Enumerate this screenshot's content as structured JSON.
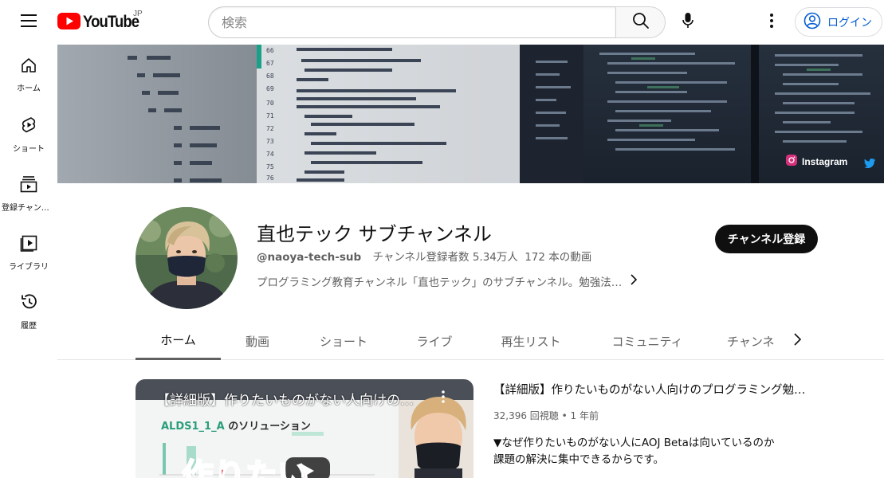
{
  "header": {
    "logo_text": "YouTube",
    "region": "JP",
    "search_placeholder": "検索",
    "login_label": "ログイン"
  },
  "sidebar": {
    "items": [
      {
        "label": "ホーム",
        "icon": "home-icon"
      },
      {
        "label": "ショート",
        "icon": "shorts-icon"
      },
      {
        "label": "登録チャンネル",
        "icon": "subscriptions-icon"
      },
      {
        "label": "ライブラリ",
        "icon": "library-icon"
      },
      {
        "label": "履歴",
        "icon": "history-icon"
      }
    ]
  },
  "banner": {
    "link_label": "Instagram"
  },
  "channel": {
    "name": "直也テック サブチャンネル",
    "handle": "@naoya-tech-sub",
    "subscribers": "チャンネル登録者数 5.34万人",
    "videos": "172 本の動画",
    "description": "プログラミング教育チャンネル「直也テック」のサブチャンネル。勉強法…",
    "subscribe_label": "チャンネル登録"
  },
  "tabs": [
    {
      "label": "ホーム",
      "active": true
    },
    {
      "label": "動画",
      "active": false
    },
    {
      "label": "ショート",
      "active": false
    },
    {
      "label": "ライブ",
      "active": false
    },
    {
      "label": "再生リスト",
      "active": false
    },
    {
      "label": "コミュニティ",
      "active": false
    },
    {
      "label": "チャンネル",
      "active": false
    }
  ],
  "featured": {
    "thumb_title": "【詳細版】作りたいものがない人向けの…",
    "thumb_subtitle": "ALDS1_1_A",
    "thumb_subtitle_suffix": "のソリューション",
    "thumb_overlay": "作りたい",
    "title": "【詳細版】作りたいものがない人向けのプログラミング勉強…",
    "views": "32,396 回視聴",
    "age": "1 年前",
    "desc_line1": "▼なぜ作りたいものがない人にAOJ Betaは向いているのか",
    "desc_line2": "課題の解決に集中できるからです。"
  },
  "colors": {
    "brand_red": "#ff0000",
    "link_blue": "#065fd4",
    "text_primary": "#0f0f0f",
    "text_secondary": "#606060"
  }
}
